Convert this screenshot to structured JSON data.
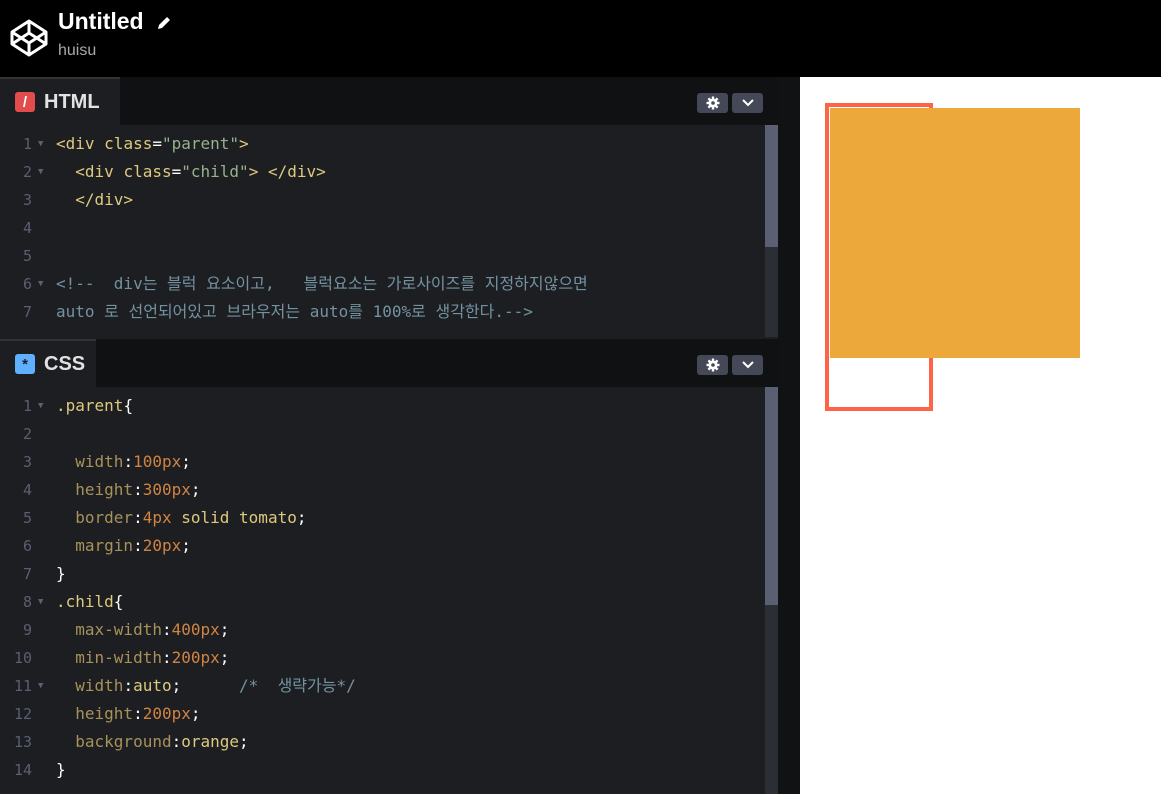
{
  "header": {
    "title": "Untitled",
    "user": "huisu"
  },
  "html_panel": {
    "tab_label": "HTML",
    "badge": "/",
    "lines": [
      {
        "n": "1",
        "fold": true,
        "parts": [
          [
            "tag",
            "<div "
          ],
          [
            "attr",
            "class"
          ],
          [
            "plain",
            "="
          ],
          [
            "str",
            "\"parent\""
          ],
          [
            "tag",
            ">"
          ]
        ]
      },
      {
        "n": "2",
        "fold": true,
        "parts": [
          [
            "plain",
            "  "
          ],
          [
            "tag",
            "<div "
          ],
          [
            "attr",
            "class"
          ],
          [
            "plain",
            "="
          ],
          [
            "str",
            "\"child\""
          ],
          [
            "tag",
            "> </div>"
          ]
        ]
      },
      {
        "n": "3",
        "fold": false,
        "parts": [
          [
            "plain",
            "  "
          ],
          [
            "tag",
            "</div>"
          ]
        ]
      },
      {
        "n": "4",
        "fold": false,
        "parts": []
      },
      {
        "n": "5",
        "fold": false,
        "parts": []
      },
      {
        "n": "6",
        "fold": true,
        "parts": [
          [
            "comment",
            "<!--  div는 블럭 요소이고,   블럭요소는 가로사이즈를 지정하지않으면"
          ]
        ]
      },
      {
        "n": "7",
        "fold": false,
        "parts": [
          [
            "comment",
            "auto 로 선언되어있고 브라우저는 auto를 100%로 생각한다.-->"
          ]
        ]
      }
    ]
  },
  "css_panel": {
    "tab_label": "CSS",
    "badge": "*",
    "lines": [
      {
        "n": "1",
        "fold": true,
        "parts": [
          [
            "sel",
            ".parent"
          ],
          [
            "plain",
            "{"
          ]
        ]
      },
      {
        "n": "2",
        "fold": false,
        "parts": []
      },
      {
        "n": "3",
        "fold": false,
        "parts": [
          [
            "plain",
            "  "
          ],
          [
            "prop",
            "width"
          ],
          [
            "plain",
            ":"
          ],
          [
            "num",
            "100px"
          ],
          [
            "plain",
            ";"
          ]
        ]
      },
      {
        "n": "4",
        "fold": false,
        "parts": [
          [
            "plain",
            "  "
          ],
          [
            "prop",
            "height"
          ],
          [
            "plain",
            ":"
          ],
          [
            "num",
            "300px"
          ],
          [
            "plain",
            ";"
          ]
        ]
      },
      {
        "n": "5",
        "fold": false,
        "parts": [
          [
            "plain",
            "  "
          ],
          [
            "prop",
            "border"
          ],
          [
            "plain",
            ":"
          ],
          [
            "num",
            "4px"
          ],
          [
            "val",
            " solid tomato"
          ],
          [
            "plain",
            ";"
          ]
        ]
      },
      {
        "n": "6",
        "fold": false,
        "parts": [
          [
            "plain",
            "  "
          ],
          [
            "prop",
            "margin"
          ],
          [
            "plain",
            ":"
          ],
          [
            "num",
            "20px"
          ],
          [
            "plain",
            ";"
          ]
        ]
      },
      {
        "n": "7",
        "fold": false,
        "parts": [
          [
            "plain",
            "}"
          ]
        ]
      },
      {
        "n": "8",
        "fold": true,
        "parts": [
          [
            "sel",
            ".child"
          ],
          [
            "plain",
            "{"
          ]
        ]
      },
      {
        "n": "9",
        "fold": false,
        "parts": [
          [
            "plain",
            "  "
          ],
          [
            "prop",
            "max-width"
          ],
          [
            "plain",
            ":"
          ],
          [
            "num",
            "400px"
          ],
          [
            "plain",
            ";"
          ]
        ]
      },
      {
        "n": "10",
        "fold": false,
        "parts": [
          [
            "plain",
            "  "
          ],
          [
            "prop",
            "min-width"
          ],
          [
            "plain",
            ":"
          ],
          [
            "num",
            "200px"
          ],
          [
            "plain",
            ";"
          ]
        ]
      },
      {
        "n": "11",
        "fold": true,
        "parts": [
          [
            "plain",
            "  "
          ],
          [
            "prop",
            "width"
          ],
          [
            "plain",
            ":"
          ],
          [
            "val",
            "auto"
          ],
          [
            "plain",
            ";      "
          ],
          [
            "comment",
            "/*  생략가능*/"
          ]
        ]
      },
      {
        "n": "12",
        "fold": false,
        "parts": [
          [
            "plain",
            "  "
          ],
          [
            "prop",
            "height"
          ],
          [
            "plain",
            ":"
          ],
          [
            "num",
            "200px"
          ],
          [
            "plain",
            ";"
          ]
        ]
      },
      {
        "n": "13",
        "fold": false,
        "parts": [
          [
            "plain",
            "  "
          ],
          [
            "prop",
            "background"
          ],
          [
            "plain",
            ":"
          ],
          [
            "val",
            "orange"
          ],
          [
            "plain",
            ";"
          ]
        ]
      },
      {
        "n": "14",
        "fold": false,
        "parts": [
          [
            "plain",
            "}"
          ]
        ]
      }
    ]
  },
  "colors": {
    "html_badge": "#e34c4c",
    "css_badge": "#5fb1ff",
    "parent_border": "tomato",
    "child_bg": "#eca83b"
  },
  "icons": {
    "logo": "codepen-logo-icon",
    "edit": "pencil-icon",
    "settings": "gear-icon",
    "collapse": "chevron-down-icon"
  }
}
